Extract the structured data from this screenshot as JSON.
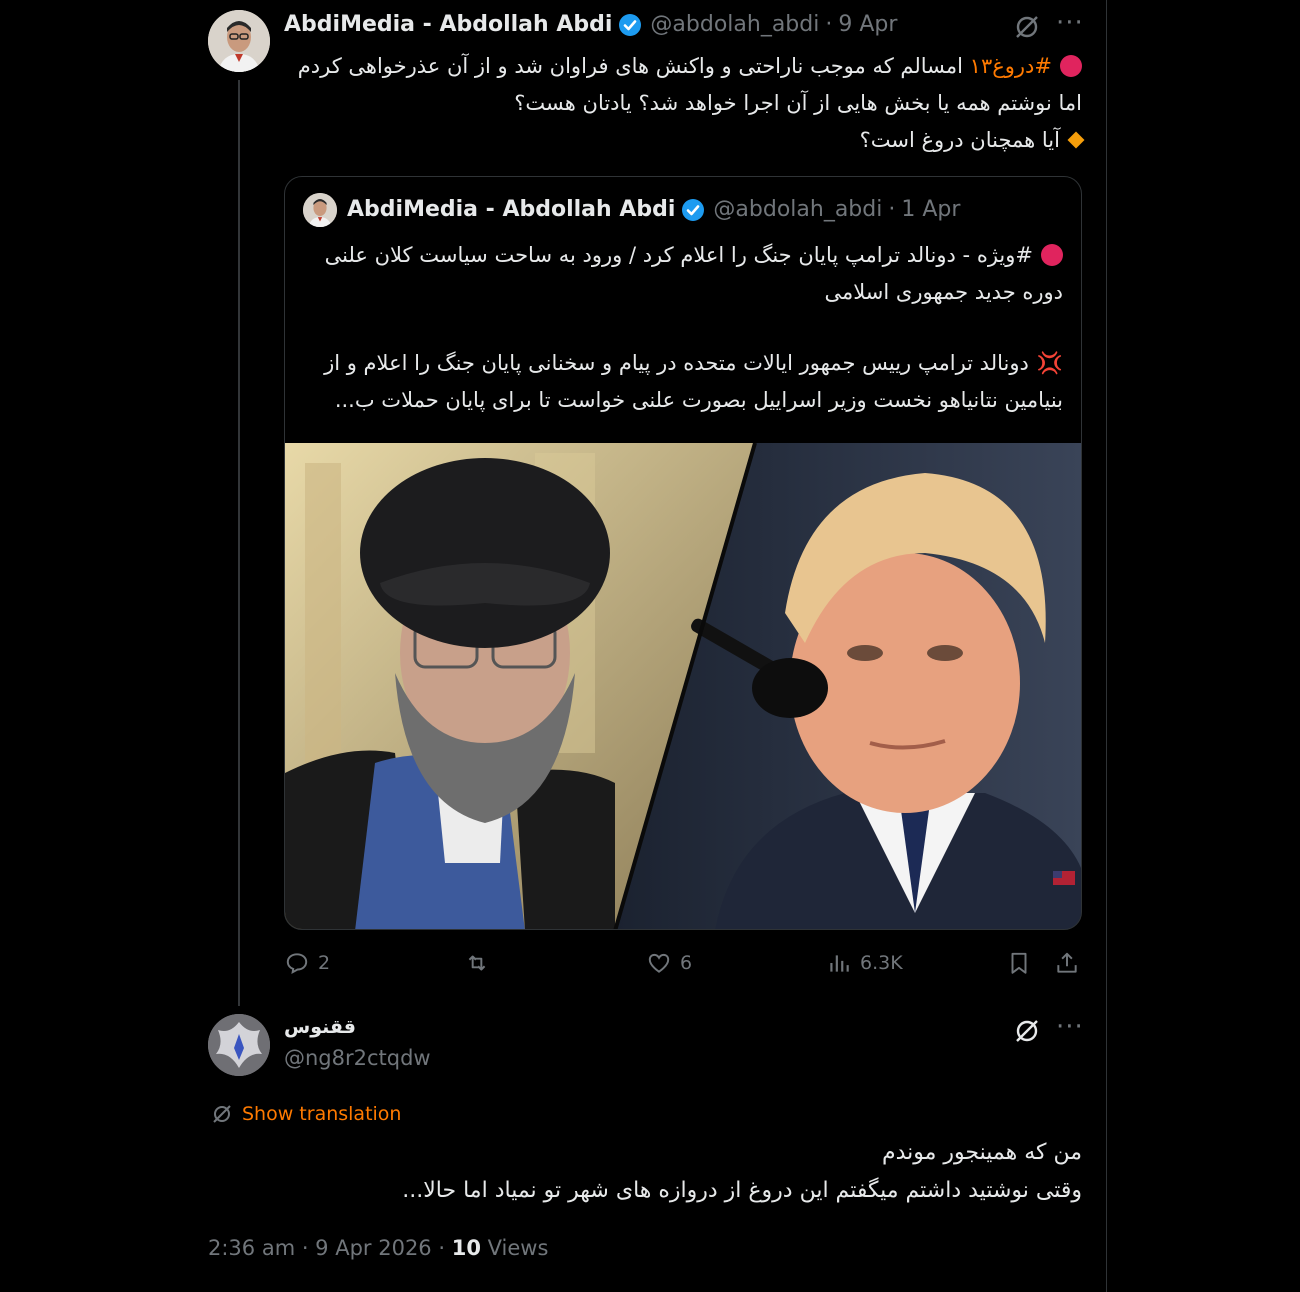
{
  "main_tweet": {
    "author_name": "AbdiMedia - Abdollah Abdi",
    "handle": "@abdolah_abdi",
    "date": "9 Apr",
    "hashtag": "#دروغ۱۳",
    "line1_rest": "امسالم که موجب ناراحتی و واکنش های فراوان شد و از آن عذرخواهی کردم",
    "line2": "اما نوشتم همه یا بخش هایی از آن اجرا خواهد شد؟ یادتان هست؟",
    "line3": "آیا همچنان دروغ است؟"
  },
  "quoted_tweet": {
    "author_name": "AbdiMedia - Abdollah Abdi",
    "handle": "@abdolah_abdi",
    "date": "1 Apr",
    "hashtag": "#ویژه",
    "para1_rest": "- دونالد ترامپ پایان جنگ را اعلام کرد / ورود به ساحت سیاست کلان علنی دوره جدید جمهوری اسلامی",
    "para2": "دونالد ترامپ رییس جمهور ایالات متحده در پیام و سخنانی پایان جنگ را اعلام و از بنیامین نتانیاهو نخست وزیر اسراییل بصورت علنی خواست تا برای پایان حملات ب..."
  },
  "actions": {
    "replies": "2",
    "likes": "6",
    "views": "6.3K"
  },
  "reply": {
    "author_name": "ققنوس",
    "handle": "@ng8r2ctqdw",
    "show_translation": "Show translation",
    "line1": "من که همینجور موندم",
    "line2": "وقتی نوشتید داشتم میگفتم این دروغ از دروازه های شهر تو نمیاد اما حالا..."
  },
  "footer": {
    "time_date": "2:36 am · 9 Apr 2026 · ",
    "views_count": "10",
    "views_label": " Views"
  },
  "colors": {
    "accent": "#ff7a00",
    "verified": "#1d9bf0",
    "muted": "#71767b",
    "red_dot": "#e0245e"
  },
  "icons": [
    "verified-badge-icon",
    "grok-icon",
    "more-icon",
    "reply-icon",
    "retweet-icon",
    "like-icon",
    "views-icon",
    "bookmark-icon",
    "share-icon",
    "translate-icon",
    "red-circle-icon",
    "orange-diamond-icon",
    "anger-icon"
  ]
}
